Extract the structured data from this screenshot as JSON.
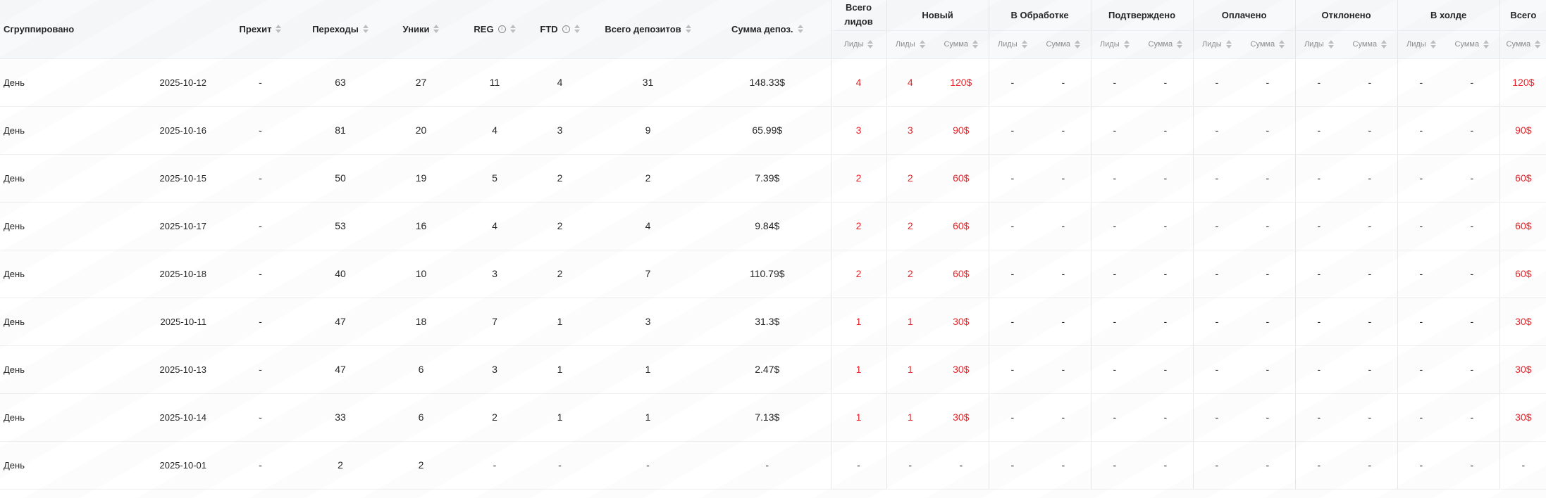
{
  "headers": {
    "grouped": "Сгруппировано",
    "prehit": "Прехит",
    "clicks": "Переходы",
    "uniques": "Уники",
    "reg": "REG",
    "ftd": "FTD",
    "total_deposits": "Всего депозитов",
    "sum_deposits": "Сумма депоз.",
    "total_leads": "Всего лидов",
    "new": "Новый",
    "processing": "В Обработке",
    "confirmed": "Подтверждено",
    "paid": "Оплачено",
    "rejected": "Отклонено",
    "hold": "В холде",
    "total": "Всего",
    "sub_leads": "Лиды",
    "sub_sum": "Сумма",
    "info_icon": "i"
  },
  "colors": {
    "accent_red": "#e8242a",
    "header_bg": "#f8f9fb"
  },
  "rows": [
    {
      "group": "День",
      "date": "2025-10-12",
      "prehit": "-",
      "clicks": "63",
      "uniques": "27",
      "reg": "11",
      "ftd": "4",
      "total_deposits": "31",
      "sum": "148.33$",
      "total_leads": "4",
      "new_leads": "4",
      "new_sum": "120$",
      "proc_leads": "-",
      "proc_sum": "-",
      "conf_leads": "-",
      "conf_sum": "-",
      "paid_leads": "-",
      "paid_sum": "-",
      "rej_leads": "-",
      "rej_sum": "-",
      "hold_leads": "-",
      "hold_sum": "-",
      "total_sum": "120$"
    },
    {
      "group": "День",
      "date": "2025-10-16",
      "prehit": "-",
      "clicks": "81",
      "uniques": "20",
      "reg": "4",
      "ftd": "3",
      "total_deposits": "9",
      "sum": "65.99$",
      "total_leads": "3",
      "new_leads": "3",
      "new_sum": "90$",
      "proc_leads": "-",
      "proc_sum": "-",
      "conf_leads": "-",
      "conf_sum": "-",
      "paid_leads": "-",
      "paid_sum": "-",
      "rej_leads": "-",
      "rej_sum": "-",
      "hold_leads": "-",
      "hold_sum": "-",
      "total_sum": "90$"
    },
    {
      "group": "День",
      "date": "2025-10-15",
      "prehit": "-",
      "clicks": "50",
      "uniques": "19",
      "reg": "5",
      "ftd": "2",
      "total_deposits": "2",
      "sum": "7.39$",
      "total_leads": "2",
      "new_leads": "2",
      "new_sum": "60$",
      "proc_leads": "-",
      "proc_sum": "-",
      "conf_leads": "-",
      "conf_sum": "-",
      "paid_leads": "-",
      "paid_sum": "-",
      "rej_leads": "-",
      "rej_sum": "-",
      "hold_leads": "-",
      "hold_sum": "-",
      "total_sum": "60$"
    },
    {
      "group": "День",
      "date": "2025-10-17",
      "prehit": "-",
      "clicks": "53",
      "uniques": "16",
      "reg": "4",
      "ftd": "2",
      "total_deposits": "4",
      "sum": "9.84$",
      "total_leads": "2",
      "new_leads": "2",
      "new_sum": "60$",
      "proc_leads": "-",
      "proc_sum": "-",
      "conf_leads": "-",
      "conf_sum": "-",
      "paid_leads": "-",
      "paid_sum": "-",
      "rej_leads": "-",
      "rej_sum": "-",
      "hold_leads": "-",
      "hold_sum": "-",
      "total_sum": "60$"
    },
    {
      "group": "День",
      "date": "2025-10-18",
      "prehit": "-",
      "clicks": "40",
      "uniques": "10",
      "reg": "3",
      "ftd": "2",
      "total_deposits": "7",
      "sum": "110.79$",
      "total_leads": "2",
      "new_leads": "2",
      "new_sum": "60$",
      "proc_leads": "-",
      "proc_sum": "-",
      "conf_leads": "-",
      "conf_sum": "-",
      "paid_leads": "-",
      "paid_sum": "-",
      "rej_leads": "-",
      "rej_sum": "-",
      "hold_leads": "-",
      "hold_sum": "-",
      "total_sum": "60$"
    },
    {
      "group": "День",
      "date": "2025-10-11",
      "prehit": "-",
      "clicks": "47",
      "uniques": "18",
      "reg": "7",
      "ftd": "1",
      "total_deposits": "3",
      "sum": "31.3$",
      "total_leads": "1",
      "new_leads": "1",
      "new_sum": "30$",
      "proc_leads": "-",
      "proc_sum": "-",
      "conf_leads": "-",
      "conf_sum": "-",
      "paid_leads": "-",
      "paid_sum": "-",
      "rej_leads": "-",
      "rej_sum": "-",
      "hold_leads": "-",
      "hold_sum": "-",
      "total_sum": "30$"
    },
    {
      "group": "День",
      "date": "2025-10-13",
      "prehit": "-",
      "clicks": "47",
      "uniques": "6",
      "reg": "3",
      "ftd": "1",
      "total_deposits": "1",
      "sum": "2.47$",
      "total_leads": "1",
      "new_leads": "1",
      "new_sum": "30$",
      "proc_leads": "-",
      "proc_sum": "-",
      "conf_leads": "-",
      "conf_sum": "-",
      "paid_leads": "-",
      "paid_sum": "-",
      "rej_leads": "-",
      "rej_sum": "-",
      "hold_leads": "-",
      "hold_sum": "-",
      "total_sum": "30$"
    },
    {
      "group": "День",
      "date": "2025-10-14",
      "prehit": "-",
      "clicks": "33",
      "uniques": "6",
      "reg": "2",
      "ftd": "1",
      "total_deposits": "1",
      "sum": "7.13$",
      "total_leads": "1",
      "new_leads": "1",
      "new_sum": "30$",
      "proc_leads": "-",
      "proc_sum": "-",
      "conf_leads": "-",
      "conf_sum": "-",
      "paid_leads": "-",
      "paid_sum": "-",
      "rej_leads": "-",
      "rej_sum": "-",
      "hold_leads": "-",
      "hold_sum": "-",
      "total_sum": "30$"
    },
    {
      "group": "День",
      "date": "2025-10-01",
      "prehit": "-",
      "clicks": "2",
      "uniques": "2",
      "reg": "-",
      "ftd": "-",
      "total_deposits": "-",
      "sum": "-",
      "total_leads": "-",
      "new_leads": "-",
      "new_sum": "-",
      "proc_leads": "-",
      "proc_sum": "-",
      "conf_leads": "-",
      "conf_sum": "-",
      "paid_leads": "-",
      "paid_sum": "-",
      "rej_leads": "-",
      "rej_sum": "-",
      "hold_leads": "-",
      "hold_sum": "-",
      "total_sum": "-"
    }
  ]
}
